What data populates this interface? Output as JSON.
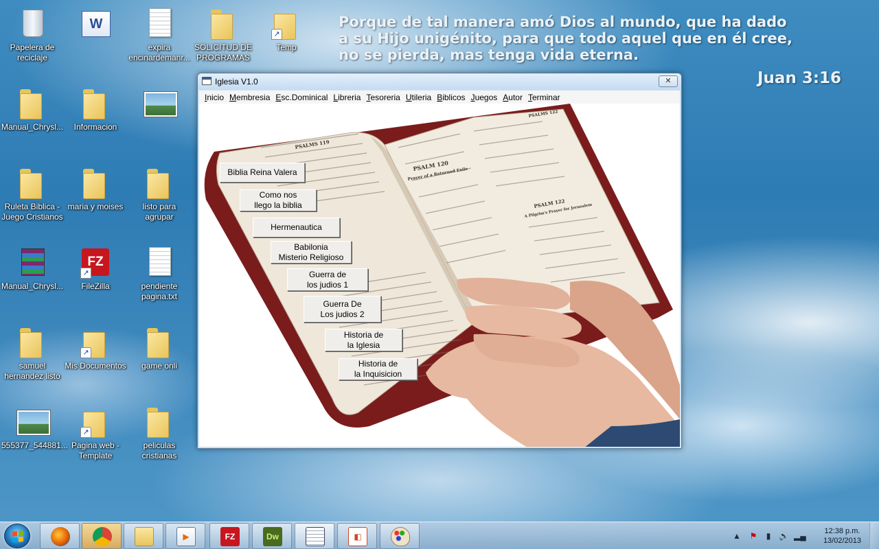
{
  "wallpaper": {
    "verse_lines": [
      "Porque de tal manera amó Dios al mundo, que ha dado",
      "a su Hijo unigénito, para que todo aquel que en él cree,",
      "no se pierda, mas tenga vida eterna."
    ],
    "verse_ref": "Juan 3:16"
  },
  "desktop_icons": [
    {
      "label": "Papelera de reciclaje",
      "icon": "recycle-bin-icon"
    },
    {
      "label": "",
      "icon": "word-document-icon"
    },
    {
      "label": "expira encinardemanr...",
      "icon": "text-file-icon"
    },
    {
      "label": "SOLICITUD DE PROGRAMAS",
      "icon": "folder-icon"
    },
    {
      "label": "Temp",
      "icon": "folder-shortcut-icon"
    },
    {
      "label": "Manual_Chrysl...",
      "icon": "folder-icon"
    },
    {
      "label": "Informacion",
      "icon": "folder-icon"
    },
    {
      "label": "",
      "icon": "image-file-icon"
    },
    {
      "label": "Ruleta Biblica - Juego Cristianos",
      "icon": "folder-icon"
    },
    {
      "label": "maria y moises",
      "icon": "folder-icon"
    },
    {
      "label": "listo para agrupar",
      "icon": "folder-icon"
    },
    {
      "label": "Manual_Chrysl...",
      "icon": "archive-icon"
    },
    {
      "label": "FileZilla",
      "icon": "filezilla-icon"
    },
    {
      "label": "pendiente pagina.txt",
      "icon": "text-file-icon"
    },
    {
      "label": "samuel hernandez listo",
      "icon": "folder-icon"
    },
    {
      "label": "Mis Documentos",
      "icon": "folder-shortcut-icon"
    },
    {
      "label": "game onli",
      "icon": "folder-icon"
    },
    {
      "label": "555377_544881...",
      "icon": "image-file-icon"
    },
    {
      "label": "Pagina web - Template",
      "icon": "folder-shortcut-icon"
    },
    {
      "label": "peliculas cristianas",
      "icon": "folder-icon"
    }
  ],
  "window": {
    "title": "Iglesia V1.0",
    "close_label": "✕",
    "menu": [
      "Inicio",
      "Membresia",
      "Esc.Dominical",
      "Libreria",
      "Tesoreria",
      "Utileria",
      "Biblicos",
      "Juegos",
      "Autor",
      "Terminar"
    ],
    "buttons": [
      "Biblia Reina Valera",
      "Como nos\nllego la biblia",
      "Hermenautica",
      "Babilonia\nMisterio Religioso",
      "Guerra de\nlos judios 1",
      "Guerra De\nLos judios 2",
      "Historia de\nla Iglesia",
      "Historia de\nla Inquisicion"
    ],
    "bible_text": {
      "psalms_left": "PSALMS 119",
      "psalm_120": "PSALM 120",
      "psalm_120_sub": "Prayer of a Returned Exile",
      "psalm_122": "PSALM 122",
      "psalm_122_sub": "A Pilgrim's Prayer for Jerusalem",
      "psalms_right": "PSALMS 122"
    }
  },
  "taskbar": {
    "apps": [
      "firefox-icon",
      "chrome-icon",
      "file-explorer-icon",
      "media-player-icon",
      "filezilla-icon",
      "dreamweaver-icon",
      "app-window-icon",
      "powerpoint-icon",
      "paint-icon"
    ],
    "app_text": {
      "filezilla": "FZ",
      "dreamweaver": "Dw"
    },
    "clock_time": "12:38 p.m.",
    "clock_date": "13/02/2013",
    "colors": {
      "firefox": "#e66000",
      "chrome": "#4c8bf5",
      "filezilla": "#c7161e",
      "dreamweaver": "#4a6a1e",
      "powerpoint": "#d24726"
    }
  }
}
